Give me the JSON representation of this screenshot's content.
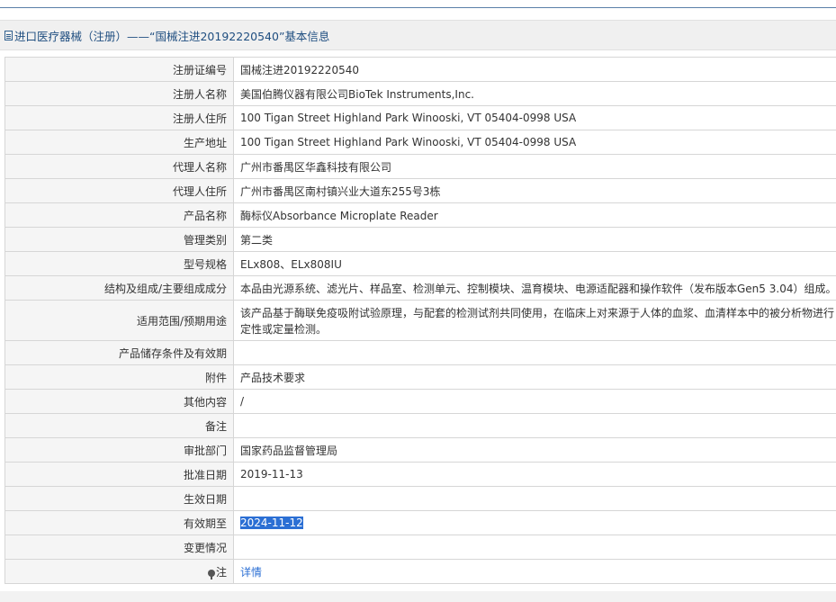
{
  "header": {
    "title": "进口医疗器械（注册）——“国械注进20192220540”基本信息"
  },
  "rows": [
    {
      "label": "注册证编号",
      "value": "国械注进20192220540"
    },
    {
      "label": "注册人名称",
      "value": "美国伯腾仪器有限公司BioTek Instruments,Inc."
    },
    {
      "label": "注册人住所",
      "value": "100 Tigan Street Highland Park Winooski, VT 05404-0998 USA"
    },
    {
      "label": "生产地址",
      "value": "100 Tigan Street Highland Park Winooski, VT 05404-0998 USA"
    },
    {
      "label": "代理人名称",
      "value": "广州市番禺区华鑫科技有限公司"
    },
    {
      "label": "代理人住所",
      "value": "广州市番禺区南村镇兴业大道东255号3栋"
    },
    {
      "label": "产品名称",
      "value": "酶标仪Absorbance Microplate Reader"
    },
    {
      "label": "管理类别",
      "value": "第二类"
    },
    {
      "label": "型号规格",
      "value": "ELx808、ELx808IU"
    },
    {
      "label": "结构及组成/主要组成成分",
      "value": "本品由光源系统、滤光片、样品室、检测单元、控制模块、温育模块、电源适配器和操作软件（发布版本Gen5 3.04）组成。"
    },
    {
      "label": "适用范围/预期用途",
      "value": "该产品基于酶联免疫吸附试验原理，与配套的检测试剂共同使用，在临床上对来源于人体的血浆、血清样本中的被分析物进行定性或定量检测。"
    },
    {
      "label": "产品储存条件及有效期",
      "value": ""
    },
    {
      "label": "附件",
      "value": "产品技术要求"
    },
    {
      "label": "其他内容",
      "value": "/"
    },
    {
      "label": "备注",
      "value": ""
    },
    {
      "label": "审批部门",
      "value": "国家药品监督管理局"
    },
    {
      "label": "批准日期",
      "value": "2019-11-13"
    },
    {
      "label": "生效日期",
      "value": ""
    },
    {
      "label": "有效期至",
      "value": "2024-11-12"
    },
    {
      "label": "变更情况",
      "value": ""
    },
    {
      "label": "注",
      "value": "详情"
    }
  ],
  "colors": {
    "title": "#1f4e80",
    "link": "#2b6fd4",
    "selection": "#2b6fd4"
  }
}
